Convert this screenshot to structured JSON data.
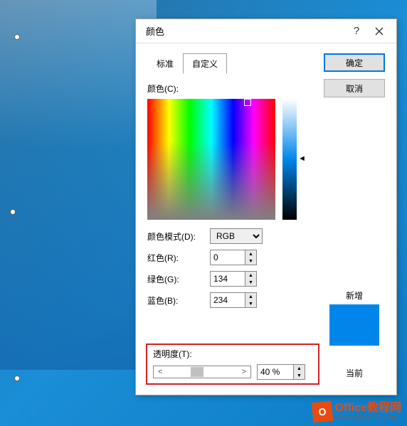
{
  "dialog": {
    "title": "颜色",
    "tabs": {
      "standard": "标准",
      "custom": "自定义"
    },
    "buttons": {
      "ok": "确定",
      "cancel": "取消"
    },
    "labels": {
      "color": "颜色(C):",
      "mode": "颜色模式(D):",
      "red": "红色(R):",
      "green": "绿色(G):",
      "blue": "蓝色(B):",
      "transparency": "透明度(T):",
      "new": "新增",
      "current": "当前"
    },
    "values": {
      "mode": "RGB",
      "red": "0",
      "green": "134",
      "blue": "234",
      "transparency": "40 %",
      "swatch_hex": "#0086ea"
    }
  },
  "watermark": {
    "brand": "Office教程网",
    "url": "www.office26.com",
    "logo_text": "O"
  }
}
